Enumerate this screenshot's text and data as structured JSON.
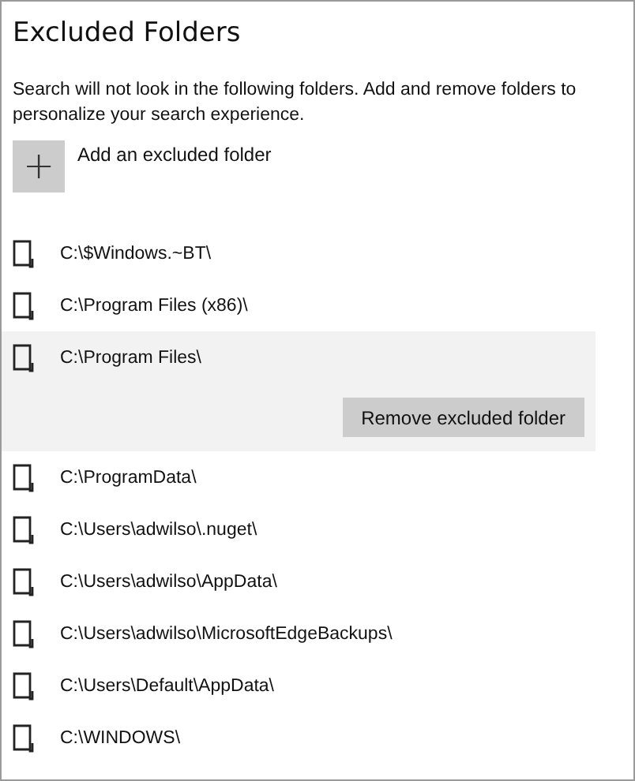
{
  "title": "Excluded Folders",
  "description": "Search will not look in the following folders. Add and remove folders to personalize your search experience.",
  "add_button": {
    "icon": "+",
    "label": "Add an excluded folder"
  },
  "remove_button": "Remove excluded folder",
  "folders": [
    {
      "path": "C:\\$Windows.~BT\\",
      "selected": false
    },
    {
      "path": "C:\\Program Files (x86)\\",
      "selected": false
    },
    {
      "path": "C:\\Program Files\\",
      "selected": true
    },
    {
      "path": "C:\\ProgramData\\",
      "selected": false
    },
    {
      "path": "C:\\Users\\adwilso\\.nuget\\",
      "selected": false
    },
    {
      "path": "C:\\Users\\adwilso\\AppData\\",
      "selected": false
    },
    {
      "path": "C:\\Users\\adwilso\\MicrosoftEdgeBackups\\",
      "selected": false
    },
    {
      "path": "C:\\Users\\Default\\AppData\\",
      "selected": false
    },
    {
      "path": "C:\\WINDOWS\\",
      "selected": false
    }
  ]
}
